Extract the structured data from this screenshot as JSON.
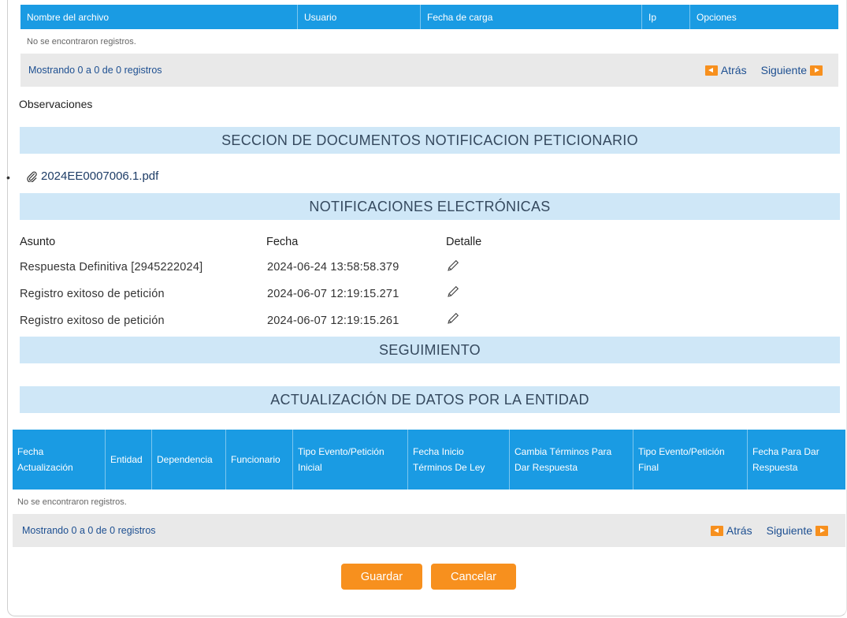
{
  "files_table": {
    "columns": [
      "Nombre del archivo",
      "Usuario",
      "Fecha de carga",
      "Ip",
      "Opciones"
    ],
    "empty_text": "No se encontraron registros.",
    "pager_info": "Mostrando 0 a 0 de 0 registros",
    "prev_label": "Atrás",
    "next_label": "Siguiente"
  },
  "observaciones_label": "Observaciones",
  "sections": {
    "documentos": "SECCION DE DOCUMENTOS NOTIFICACION PETICIONARIO",
    "notificaciones": "NOTIFICACIONES ELECTRÓNICAS",
    "seguimiento": "SEGUIMIENTO",
    "actualizacion": "ACTUALIZACIÓN DE DATOS POR LA ENTIDAD"
  },
  "document": {
    "bullet": "•",
    "filename": "2024EE0007006.1.pdf"
  },
  "notifications": {
    "headers": {
      "asunto": "Asunto",
      "fecha": "Fecha",
      "detalle": "Detalle"
    },
    "rows": [
      {
        "asunto": "Respuesta Definitiva [2945222024]",
        "fecha": "2024-06-24 13:58:58.379"
      },
      {
        "asunto": "Registro exitoso de petición",
        "fecha": "2024-06-07 12:19:15.271"
      },
      {
        "asunto": "Registro exitoso de petición",
        "fecha": "2024-06-07 12:19:15.261"
      }
    ]
  },
  "update_table": {
    "columns": [
      "Fecha Actualización",
      "Entidad",
      "Dependencia",
      "Funcionario",
      "Tipo Evento/Petición Inicial",
      "Fecha Inicio Términos De Ley",
      "Cambia Términos Para Dar Respuesta",
      "Tipo Evento/Petición Final",
      "Fecha Para Dar Respuesta"
    ],
    "empty_text": "No se encontraron registros.",
    "pager_info": "Mostrando 0 a 0 de 0 registros",
    "prev_label": "Atrás",
    "next_label": "Siguiente"
  },
  "buttons": {
    "save": "Guardar",
    "cancel": "Cancelar"
  },
  "colors": {
    "header_blue": "#1a9be3",
    "band_blue": "#cfe7f7",
    "accent_orange": "#f7901e",
    "link_blue": "#1d4f91"
  },
  "icons": {
    "attachment": "paperclip-icon",
    "detail": "pencil-icon",
    "prev": "arrow-left-icon",
    "next": "arrow-right-icon"
  }
}
